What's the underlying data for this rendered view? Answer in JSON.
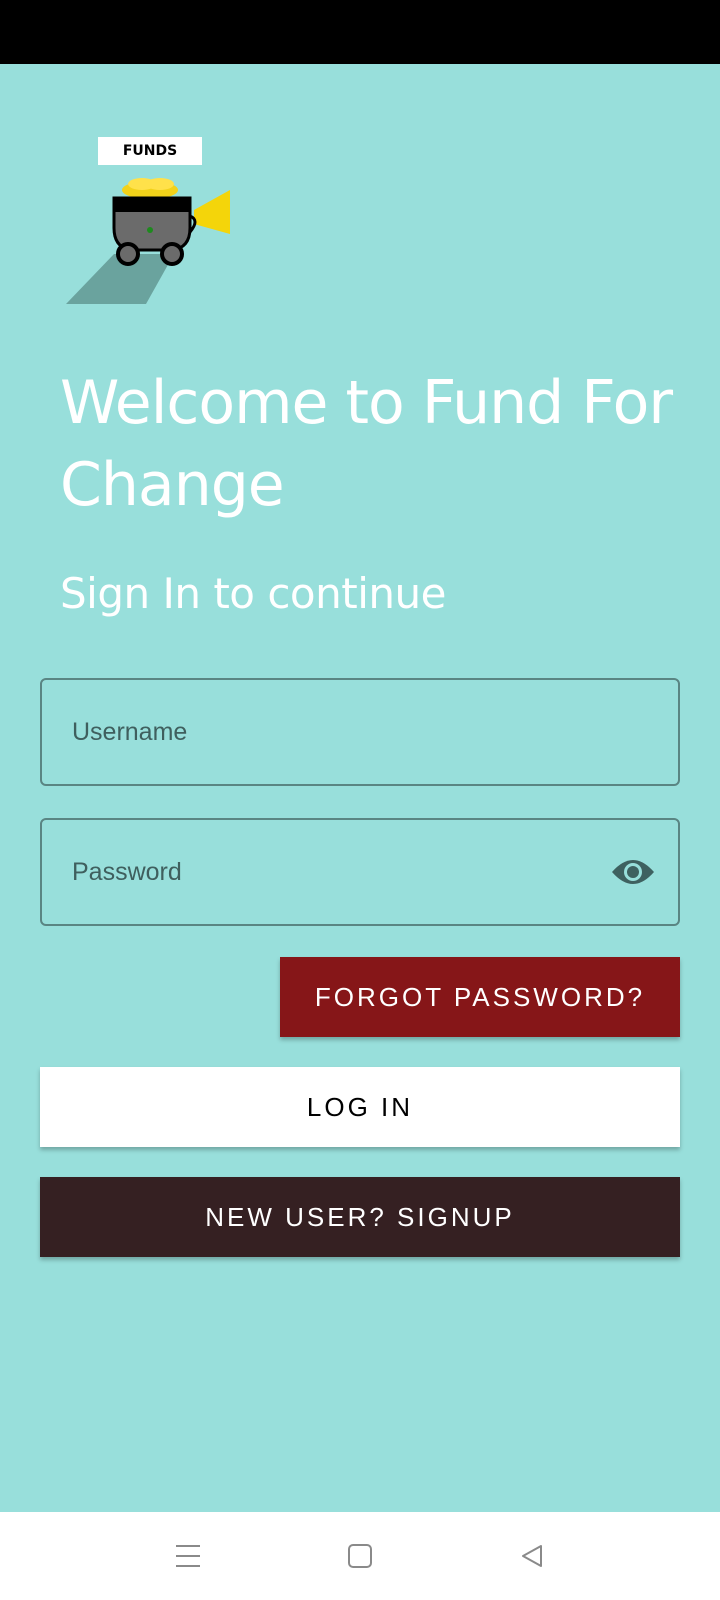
{
  "status_bar": {},
  "logo": {
    "tag_text": "FUNDS"
  },
  "welcome": {
    "title": "Welcome to Fund For Change",
    "subtitle": "Sign In to continue"
  },
  "form": {
    "username_placeholder": "Username",
    "username_value": "",
    "password_placeholder": "Password",
    "password_value": "",
    "password_toggle_icon": "eye-icon"
  },
  "buttons": {
    "forgot_password": "FORGOT PASSWORD?",
    "login": "LOG IN",
    "signup": "NEW USER? SIGNUP"
  },
  "nav_bar": {
    "menu_icon": "menu-icon",
    "home_icon": "home-icon",
    "back_icon": "back-icon"
  },
  "colors": {
    "background": "#98dfdb",
    "forgot_button": "#861618",
    "login_button": "#ffffff",
    "signup_button": "#352022",
    "field_border": "#5a8583"
  }
}
